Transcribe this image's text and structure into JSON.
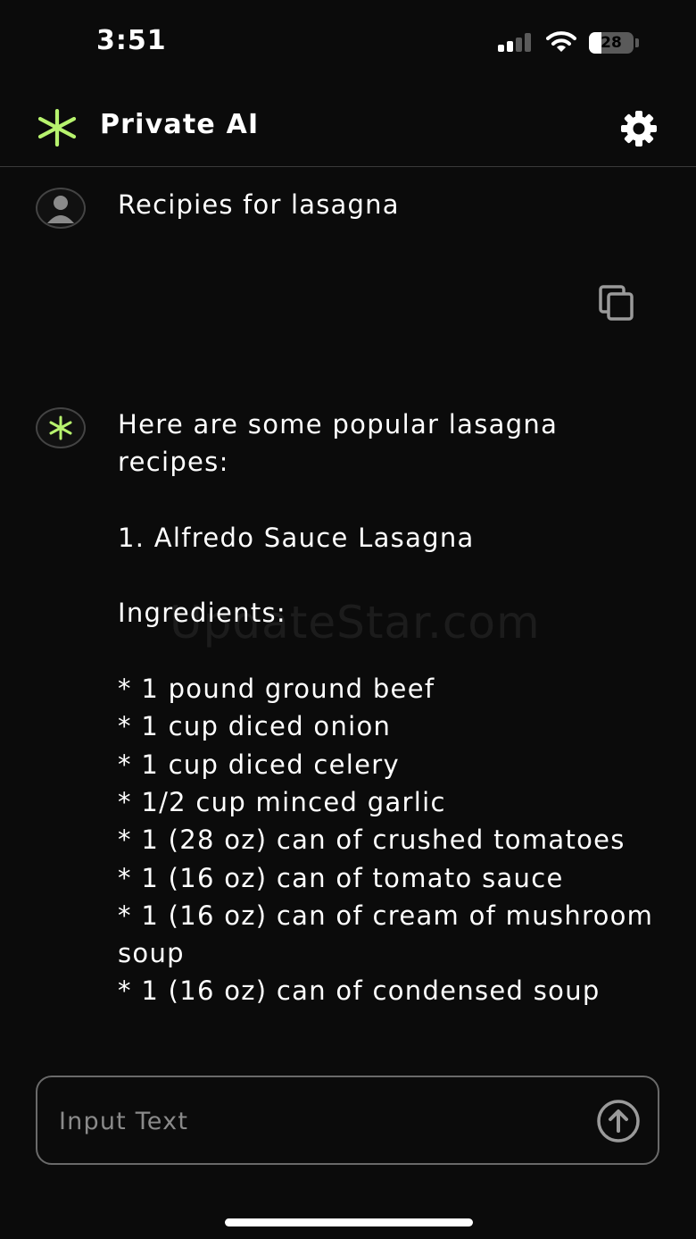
{
  "status_bar": {
    "time": "3:51",
    "battery_percent": "28",
    "battery_level": 0.28,
    "signal_bars_active": 2,
    "signal_bars_total": 4
  },
  "header": {
    "title": "Private AI",
    "logo_icon": "sparkle-asterisk-icon",
    "settings_icon": "gear-icon"
  },
  "conversation": {
    "user_message": "Recipies for lasagna",
    "copy_icon": "copy-icon",
    "ai_message": {
      "intro": "Here are some popular lasagna recipes:",
      "recipe_title": "1. Alfredo Sauce Lasagna",
      "ingredients_heading": "Ingredients:",
      "ingredients": [
        "* 1 pound ground beef",
        "* 1 cup diced onion",
        "* 1 cup diced celery",
        "* 1/2 cup minced garlic",
        "* 1 (28 oz) can of crushed tomatoes",
        "* 1 (16 oz) can of tomato sauce",
        "* 1 (16 oz) can of cream of mushroom soup",
        "* 1 (16 oz) can of condensed soup"
      ]
    }
  },
  "watermark": "UpdateStar.com",
  "composer": {
    "placeholder": "Input Text",
    "send_icon": "arrow-up-circle-icon"
  },
  "colors": {
    "background": "#0b0b0b",
    "accent": "#b7f36e",
    "text": "#ffffff",
    "muted": "#8a8a8a"
  }
}
